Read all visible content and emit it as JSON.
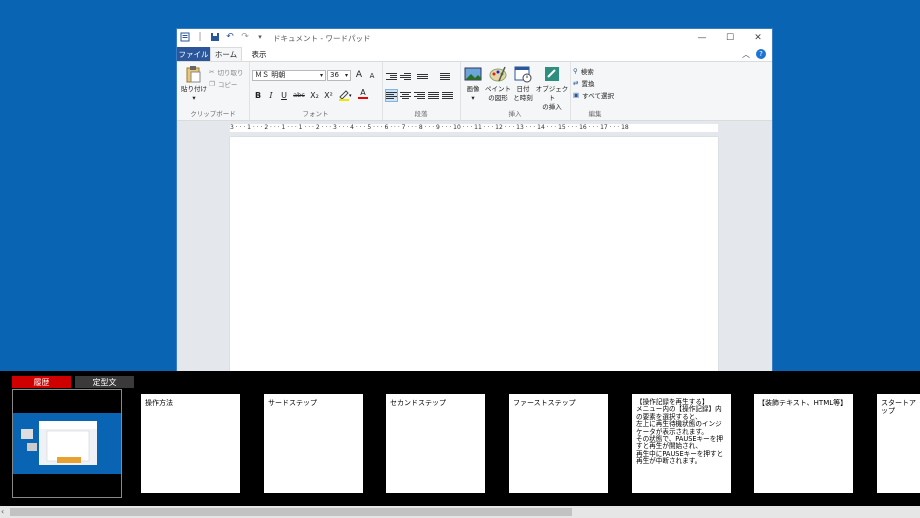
{
  "window": {
    "title": "ドキュメント - ワードパッド",
    "controls": {
      "minimize": "—",
      "maximize": "☐",
      "close": "✕"
    }
  },
  "tabs": {
    "file": "ファイル",
    "home": "ホーム",
    "view": "表示"
  },
  "ribbon": {
    "clipboard": {
      "label": "クリップボード",
      "paste": "貼り付け",
      "paste_arrow": "▾",
      "cut": "切り取り",
      "copy": "コピー"
    },
    "font": {
      "label": "フォント",
      "family": "ＭＳ 明朝",
      "size": "36",
      "grow": "A",
      "shrink": "A",
      "bold": "B",
      "italic": "I",
      "underline": "U",
      "strike": "abc",
      "subscript": "X₂",
      "superscript": "X²",
      "color": "A"
    },
    "paragraph": {
      "label": "段落"
    },
    "insert": {
      "label": "挿入",
      "picture": "画像",
      "paint": "ペイント\nの図形",
      "datetime": "日付\nと時刻",
      "object": "オブジェクト\nの挿入"
    },
    "edit": {
      "label": "編集",
      "find": "検索",
      "replace": "置換",
      "select_all": "すべて選択"
    }
  },
  "ruler": "3 · · · 1 · · · 2 · · · 1 · · · 1 · · · 2 · · · 3 · · · 4 · · · 5 · · · 6 · · · 7 · · · 8 · · · 9 · · · 10 · · · 11 · · · 12 · · · 13 · · · 14 · · · 15 · · · 16 · · · 17 · · · 18",
  "panel": {
    "tabs": {
      "history": "履歴",
      "templates": "定型文"
    },
    "cards": [
      {
        "text": "操作方法"
      },
      {
        "text": "サードステップ"
      },
      {
        "text": "セカンドステップ"
      },
      {
        "text": "ファーストステップ"
      },
      {
        "text": "【操作記録を再生する】\nメニュー内の【操作記録】内の要素を選択すると、\n左上に再生待機状態のインジケータが表示されます。\nその状態で、PAUSEキーを押すと再生が開始され、\n再生中にPAUSEキーを押すと再生が中断されます。"
      },
      {
        "text": "【装飾テキスト、HTML等】"
      },
      {
        "text": "スタートアップ"
      }
    ],
    "scroll_left": "‹"
  }
}
